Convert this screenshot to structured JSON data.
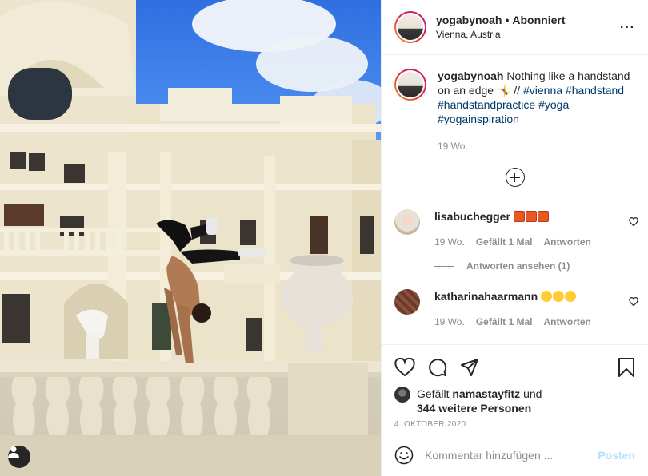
{
  "post": {
    "author": "yogabynoah",
    "separator": "•",
    "follow_status": "Abonniert",
    "location": "Vienna, Austria",
    "more_icon": "more-horizontal-icon"
  },
  "caption": {
    "username": "yogabynoah",
    "text": "Nothing like a handstand on an edge",
    "emoji": "🤸",
    "text2": " //",
    "hashtags": [
      "#vienna",
      "#handstand",
      "#handstandpractice",
      "#yoga",
      "#yogainspiration"
    ],
    "age": "19 Wo."
  },
  "comments": [
    {
      "username": "lisabuchegger",
      "emoji": "💥💥💥",
      "age": "19 Wo.",
      "likes": "Gefällt 1 Mal",
      "reply_label": "Antworten"
    },
    {
      "username": "katharinahaarmann",
      "emoji": "😍😍😍",
      "age": "19 Wo.",
      "likes": "Gefällt 1 Mal",
      "reply_label": "Antworten"
    }
  ],
  "view_replies": "Antworten ansehen (1)",
  "likes": {
    "prefix": "Gefällt",
    "user": "namastayfitz",
    "middle": "und",
    "others": "344 weitere Personen"
  },
  "date": "4. OKTOBER 2020",
  "add_comment": {
    "placeholder": "Kommentar hinzufügen ...",
    "post_label": "Posten"
  },
  "colors": {
    "link": "#00376b",
    "muted": "#8e8e8e",
    "post_disabled": "#b2dffc"
  }
}
